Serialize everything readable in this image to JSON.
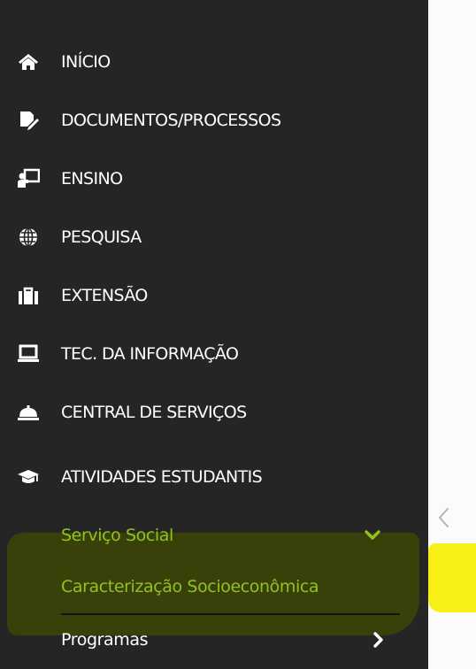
{
  "menu": {
    "items": [
      {
        "label": "INÍCIO",
        "icon": "home-icon"
      },
      {
        "label": "DOCUMENTOS/PROCESSOS",
        "icon": "document-edit-icon"
      },
      {
        "label": "ENSINO",
        "icon": "teacher-board-icon"
      },
      {
        "label": "PESQUISA",
        "icon": "globe-icon"
      },
      {
        "label": "EXTENSÃO",
        "icon": "briefcase-icon"
      },
      {
        "label": "TEC. DA INFORMAÇÃO",
        "icon": "laptop-icon"
      },
      {
        "label": "CENTRAL DE SERVIÇOS",
        "icon": "service-bell-icon"
      },
      {
        "label": "ATIVIDADES ESTUDANTIS",
        "icon": "graduation-cap-icon"
      }
    ],
    "submenu": {
      "servico_social": "Serviço Social",
      "caracterizacao": "Caracterização Socioeconômica",
      "programas": "Programas"
    }
  },
  "colors": {
    "sidebar_bg": "#252525",
    "active_green": "#8fc31f",
    "highlight_mark": "#39400a",
    "yellow_mark": "#f7ef16",
    "page_bg": "#fbfbfb"
  },
  "icons": {
    "collapse_toggle": "chevron-left-icon",
    "expanded": "chevron-down-icon",
    "collapsed": "chevron-right-icon"
  }
}
